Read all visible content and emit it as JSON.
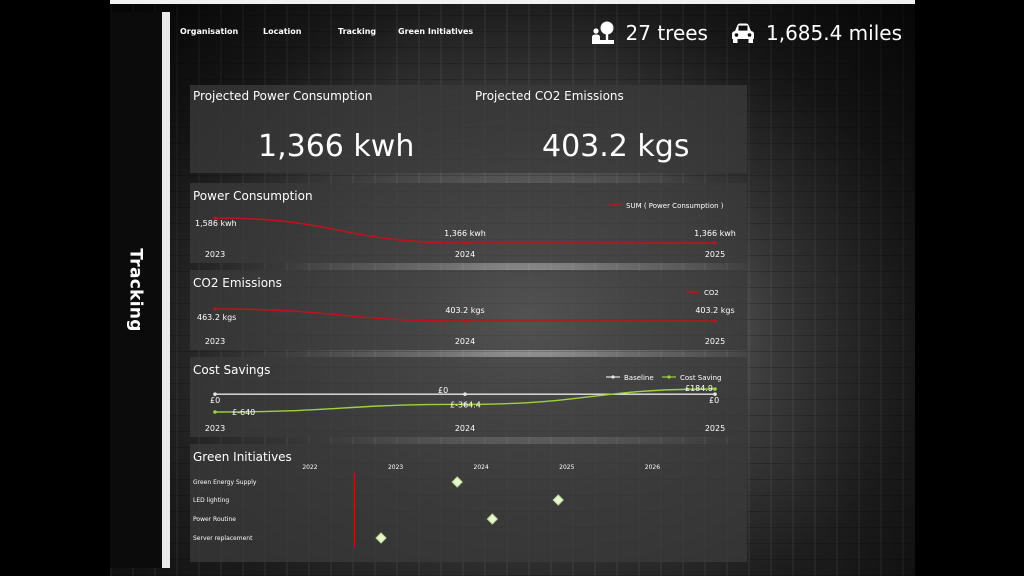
{
  "nav": {
    "organisation": "Organisation",
    "location": "Location",
    "tracking": "Tracking",
    "green_initiatives": "Green Initiatives"
  },
  "side_title": "Tracking",
  "stats": {
    "trees": "27 trees",
    "miles": "1,685.4 miles",
    "tree_icon": "tree-person-icon",
    "car_icon": "car-icon"
  },
  "kpi": {
    "power_title": "Projected Power Consumption",
    "power_value": "1,366 kwh",
    "co2_title": "Projected CO2 Emissions",
    "co2_value": "403.2 kgs"
  },
  "colors": {
    "accent_red": "#c0121e",
    "baseline": "#e6e6e6",
    "saving_green": "#9bd33a",
    "marker": "#e8f5d2"
  },
  "chart_data": [
    {
      "type": "line",
      "title": "Power Consumption",
      "x": [
        "2023",
        "2024",
        "2025"
      ],
      "series": [
        {
          "name": "SUM ( Power Consumption )",
          "values": [
            1586,
            1366,
            1366
          ],
          "labels": [
            "1,586 kwh",
            "1,366 kwh",
            "1,366 kwh"
          ]
        }
      ],
      "legend": "top-right"
    },
    {
      "type": "line",
      "title": "CO2 Emissions",
      "x": [
        "2023",
        "2024",
        "2025"
      ],
      "series": [
        {
          "name": "CO2",
          "values": [
            463.2,
            403.2,
            403.2
          ],
          "labels": [
            "463.2 kgs",
            "403.2 kgs",
            "403.2 kgs"
          ]
        }
      ],
      "legend": "top-right"
    },
    {
      "type": "line",
      "title": "Cost Savings",
      "x": [
        "2023",
        "2024",
        "2025"
      ],
      "series": [
        {
          "name": "Baseline",
          "values": [
            0,
            0,
            0
          ],
          "labels": [
            "£0",
            "£0",
            "£0"
          ]
        },
        {
          "name": "Cost Saving",
          "values": [
            -640,
            -364.4,
            184.9
          ],
          "labels": [
            "£-640",
            "£-364.4",
            "£184.9"
          ]
        }
      ],
      "legend": "top-right"
    },
    {
      "type": "scatter",
      "title": "Green Initiatives",
      "x_ticks": [
        "2022",
        "2023",
        "2024",
        "2025",
        "2026"
      ],
      "x_range": [
        2022,
        2026.7
      ],
      "categories": [
        "Green Energy Supply",
        "LED lighting",
        "Power Routine",
        "Server replacement"
      ],
      "points": [
        {
          "category": "Green Energy Supply",
          "x": 2023.72
        },
        {
          "category": "LED lighting",
          "x": 2024.9
        },
        {
          "category": "Power Routine",
          "x": 2024.13
        },
        {
          "category": "Server replacement",
          "x": 2022.83
        }
      ],
      "reference_line_x": 2022.52
    }
  ]
}
